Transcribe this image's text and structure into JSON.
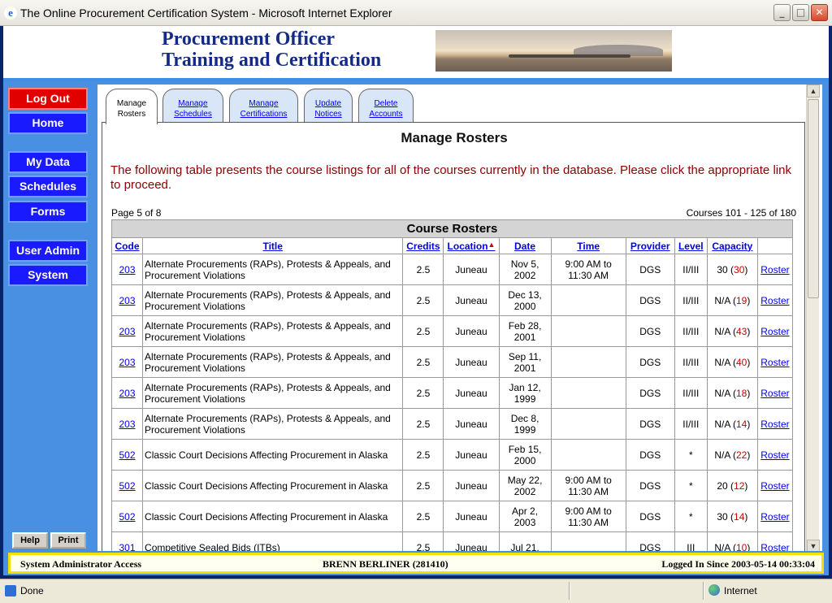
{
  "window": {
    "title": "The Online Procurement Certification System - Microsoft Internet Explorer",
    "minimize": "_",
    "maximize": "□",
    "close": "✕"
  },
  "banner": {
    "line1": "Procurement Officer",
    "line2": "Training and Certification"
  },
  "nav": {
    "logout": "Log Out",
    "home": "Home",
    "my_data": "My Data",
    "schedules": "Schedules",
    "forms": "Forms",
    "user_admin": "User Admin",
    "system": "System",
    "help": "Help",
    "print": "Print"
  },
  "tabs": [
    {
      "line1": "Manage",
      "line2": "Rosters"
    },
    {
      "line1": "Manage",
      "line2": "Schedules"
    },
    {
      "line1": "Manage",
      "line2": "Certifications"
    },
    {
      "line1": "Update",
      "line2": "Notices"
    },
    {
      "line1": "Delete",
      "line2": "Accounts"
    }
  ],
  "main": {
    "heading": "Manage Rosters",
    "intro": "The following table presents the course listings for all of the courses currently in the database. Please click the appropriate link to proceed.",
    "page_info": "Page 5 of 8",
    "course_info": "Courses 101 - 125 of 180"
  },
  "table": {
    "caption": "Course Rosters",
    "headers": {
      "code": "Code",
      "title": "Title",
      "credits": "Credits",
      "location": "Location",
      "date": "Date",
      "time": "Time",
      "provider": "Provider",
      "level": "Level",
      "capacity": "Capacity"
    },
    "sort_indicator": "▲",
    "roster_label": "Roster",
    "rows": [
      {
        "code": "203",
        "title": "Alternate Procurements (RAPs), Protests & Appeals, and Procurement Violations",
        "credits": "2.5",
        "location": "Juneau",
        "date": "Nov 5, 2002",
        "time": "9:00 AM to 11:30 AM",
        "provider": "DGS",
        "level": "II/III",
        "cap": "30",
        "cap_n": "30"
      },
      {
        "code": "203",
        "title": "Alternate Procurements (RAPs), Protests & Appeals, and Procurement Violations",
        "credits": "2.5",
        "location": "Juneau",
        "date": "Dec 13, 2000",
        "time": "",
        "provider": "DGS",
        "level": "II/III",
        "cap": "N/A",
        "cap_n": "19"
      },
      {
        "code": "203",
        "title": "Alternate Procurements (RAPs), Protests & Appeals, and Procurement Violations",
        "credits": "2.5",
        "location": "Juneau",
        "date": "Feb 28, 2001",
        "time": "",
        "provider": "DGS",
        "level": "II/III",
        "cap": "N/A",
        "cap_n": "43"
      },
      {
        "code": "203",
        "title": "Alternate Procurements (RAPs), Protests & Appeals, and Procurement Violations",
        "credits": "2.5",
        "location": "Juneau",
        "date": "Sep 11, 2001",
        "time": "",
        "provider": "DGS",
        "level": "II/III",
        "cap": "N/A",
        "cap_n": "40"
      },
      {
        "code": "203",
        "title": "Alternate Procurements (RAPs), Protests & Appeals, and Procurement Violations",
        "credits": "2.5",
        "location": "Juneau",
        "date": "Jan 12, 1999",
        "time": "",
        "provider": "DGS",
        "level": "II/III",
        "cap": "N/A",
        "cap_n": "18"
      },
      {
        "code": "203",
        "title": "Alternate Procurements (RAPs), Protests & Appeals, and Procurement Violations",
        "credits": "2.5",
        "location": "Juneau",
        "date": "Dec 8, 1999",
        "time": "",
        "provider": "DGS",
        "level": "II/III",
        "cap": "N/A",
        "cap_n": "14"
      },
      {
        "code": "502",
        "title": "Classic Court Decisions Affecting Procurement in Alaska",
        "credits": "2.5",
        "location": "Juneau",
        "date": "Feb 15, 2000",
        "time": "",
        "provider": "DGS",
        "level": "*",
        "cap": "N/A",
        "cap_n": "22"
      },
      {
        "code": "502",
        "title": "Classic Court Decisions Affecting Procurement in Alaska",
        "credits": "2.5",
        "location": "Juneau",
        "date": "May 22, 2002",
        "time": "9:00 AM to 11:30 AM",
        "provider": "DGS",
        "level": "*",
        "cap": "20",
        "cap_n": "12"
      },
      {
        "code": "502",
        "title": "Classic Court Decisions Affecting Procurement in Alaska",
        "credits": "2.5",
        "location": "Juneau",
        "date": "Apr 2, 2003",
        "time": "9:00 AM to 11:30 AM",
        "provider": "DGS",
        "level": "*",
        "cap": "30",
        "cap_n": "14"
      },
      {
        "code": "301",
        "title": "Competitive Sealed Bids (ITBs)",
        "credits": "2.5",
        "location": "Juneau",
        "date": "Jul 21,",
        "time": "",
        "provider": "DGS",
        "level": "III",
        "cap": "N/A",
        "cap_n": "10"
      }
    ]
  },
  "app_status": {
    "left": "System Administrator Access",
    "center": "BRENN BERLINER (281410)",
    "right": "Logged In Since 2003-05-14 00:33:04"
  },
  "ie_status": {
    "done": "Done",
    "zone": "Internet"
  }
}
